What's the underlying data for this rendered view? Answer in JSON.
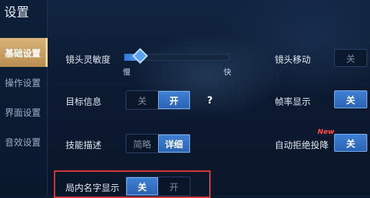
{
  "header": {
    "title": "设置"
  },
  "sidebar": {
    "tabs": [
      {
        "label": "基础设置",
        "active": true
      },
      {
        "label": "操作设置",
        "active": false
      },
      {
        "label": "界面设置",
        "active": false
      },
      {
        "label": "音效设置",
        "active": false
      }
    ]
  },
  "settings": {
    "camera_sensitivity": {
      "label": "镜头灵敏度",
      "min_label": "慢",
      "max_label": "快",
      "value_fraction": 0.15
    },
    "camera_move": {
      "label": "镜头移动",
      "value": "关"
    },
    "target_info": {
      "label": "目标信息",
      "off": "关",
      "on": "开",
      "selected": "开",
      "help": "?"
    },
    "fps_display": {
      "label": "帧率显示",
      "value": "关"
    },
    "skill_desc": {
      "label": "技能描述",
      "brief": "简略",
      "detail": "详细",
      "selected": "详细"
    },
    "auto_reject_surrender": {
      "label": "自动拒绝投降",
      "badge": "New",
      "value": "关"
    },
    "ingame_name_display": {
      "label": "局内名字显示",
      "off": "关",
      "on": "开",
      "selected": "关"
    }
  },
  "colors": {
    "accent_blue": "#3f80d4",
    "tab_gold": "#d8b47a",
    "highlight_red": "#d93a3a",
    "badge_red": "#ff4d4d"
  }
}
